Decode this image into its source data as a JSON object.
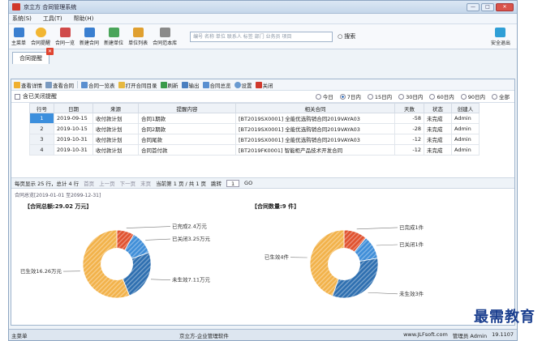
{
  "window": {
    "title": "京立方 合同管理系统",
    "controls": [
      "—",
      "□",
      "✕"
    ]
  },
  "menu": [
    "系统(S)",
    "工具(T)",
    "帮助(H)"
  ],
  "toolbar": {
    "buttons": [
      {
        "label": "主菜单",
        "color": "#3a7fd0"
      },
      {
        "label": "合同提醒",
        "color": "#f2b632"
      },
      {
        "label": "合同一览",
        "color": "#d04a4a"
      },
      {
        "label": "新建合同",
        "color": "#3a7fd0"
      },
      {
        "label": "新建单位",
        "color": "#4aa55a"
      },
      {
        "label": "单位列表",
        "color": "#e0a030"
      },
      {
        "label": "合同范本库",
        "color": "#8a8a8a"
      }
    ],
    "search_placeholder": "编号 名称 单位 联系人 标签 部门 业务员 项目",
    "search_button": "搜索",
    "exit": "安全退出"
  },
  "tab": {
    "label": "合同提醒"
  },
  "actions": [
    {
      "label": "查看详情",
      "color": "#f0b030"
    },
    {
      "label": "查看合同",
      "color": "#7a9ac0"
    },
    {
      "label": "合同一览表",
      "color": "#5a8fd0"
    },
    {
      "label": "打开合同目录",
      "color": "#e6b840"
    },
    {
      "label": "刷新",
      "color": "#3a9a4a"
    },
    {
      "label": "输出",
      "color": "#4a7fc0"
    },
    {
      "label": "合同总览",
      "color": "#5a8fd0"
    },
    {
      "label": "设置",
      "color": "#6a9ad0"
    },
    {
      "label": "关闭",
      "color": "#d0382b"
    }
  ],
  "filter": {
    "include_closed": "含已关闭提醒",
    "ranges": [
      "今日",
      "7日内",
      "15日内",
      "30日内",
      "60日内",
      "90日内",
      "全部"
    ],
    "selected": "7日内"
  },
  "table": {
    "headers": [
      "行号",
      "日期",
      "来源",
      "提醒内容",
      "相关合同",
      "天数",
      "状态",
      "创建人"
    ],
    "rows": [
      [
        "1",
        "2019-09-15",
        "收付款计划",
        "合同1期款",
        "[BT2019SX0001] 全能优选购销合同2019VAYA03",
        "-58",
        "未完成",
        "Admin"
      ],
      [
        "2",
        "2019-10-15",
        "收付款计划",
        "合同2期款",
        "[BT2019SX0001] 全能优选购销合同2019VAYA03",
        "-28",
        "未完成",
        "Admin"
      ],
      [
        "3",
        "2019-10-31",
        "收付款计划",
        "合同尾款",
        "[BT2019SX0001] 全能优选购销合同2019VAYA03",
        "-12",
        "未完成",
        "Admin"
      ],
      [
        "4",
        "2019-10-31",
        "收付款计划",
        "合同首付款",
        "[BT2019FK0001] 智能柜产品技术开发合同",
        "-12",
        "未完成",
        "Admin"
      ]
    ]
  },
  "pager": {
    "summary": "每页显示 25 行，总计 4 行",
    "first": "首页",
    "prev": "上一页",
    "next": "下一页",
    "last": "末页",
    "current": "当前第 1 页 / 共 1 页",
    "jump": "跳转",
    "page": "1",
    "go": "GO"
  },
  "overview_title": "合同总览[2019-01-01 至2099-12-31]",
  "chart_data": [
    {
      "type": "pie",
      "title": "【合同总额:29.02 万元】",
      "categories": [
        "已完成2.4万元",
        "已关闭3.25万元",
        "未生效7.11万元",
        "已生效16.26万元"
      ],
      "values": [
        2.4,
        3.25,
        7.11,
        16.26
      ],
      "colors": [
        "#e0522f",
        "#3f8ed8",
        "#2e6fb0",
        "#f2b24a"
      ]
    },
    {
      "type": "pie",
      "title": "【合同数量:9 件】",
      "categories": [
        "已完成1件",
        "已关闭1件",
        "未生效3件",
        "已生效4件"
      ],
      "values": [
        1,
        1,
        3,
        4
      ],
      "colors": [
        "#e0522f",
        "#3f8ed8",
        "#2e6fb0",
        "#f2b24a"
      ]
    }
  ],
  "statusbar": {
    "menu": "主菜单",
    "center": "京立方-企业管理软件",
    "site": "www.JLFsoft.com",
    "user": "管理员 Admin",
    "version": "19.1107"
  },
  "watermark": "最需教育"
}
